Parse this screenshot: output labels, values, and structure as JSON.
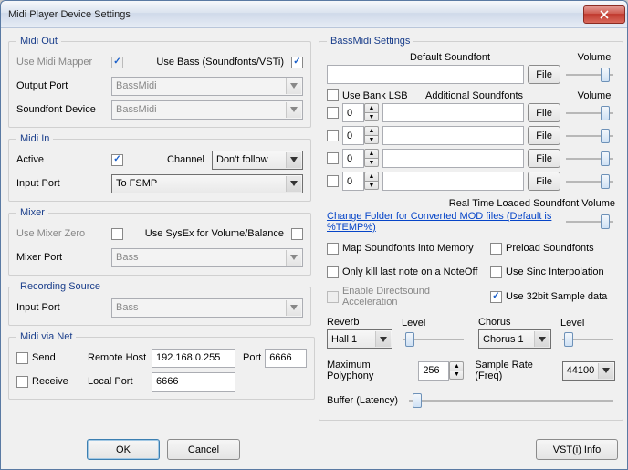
{
  "window": {
    "title": "Midi Player Device Settings"
  },
  "midiOut": {
    "legend": "Midi Out",
    "useMapper": "Use Midi Mapper",
    "useBass": "Use Bass (Soundfonts/VSTi)",
    "outputPort": "Output Port",
    "outputPortVal": "BassMidi",
    "sfDevice": "Soundfont Device",
    "sfDeviceVal": "BassMidi"
  },
  "midiIn": {
    "legend": "Midi In",
    "active": "Active",
    "channel": "Channel",
    "channelVal": "Don't follow",
    "inputPort": "Input Port",
    "inputPortVal": "To FSMP"
  },
  "mixer": {
    "legend": "Mixer",
    "useZero": "Use Mixer Zero",
    "useSysex": "Use SysEx for Volume/Balance",
    "mixerPort": "Mixer Port",
    "mixerPortVal": "Bass"
  },
  "rec": {
    "legend": "Recording Source",
    "inputPort": "Input Port",
    "inputPortVal": "Bass"
  },
  "net": {
    "legend": "Midi via Net",
    "send": "Send",
    "receive": "Receive",
    "remoteHost": "Remote Host",
    "remoteHostVal": "192.168.0.255",
    "port": "Port",
    "remotePortVal": "6666",
    "localPort": "Local Port",
    "localPortVal": "6666"
  },
  "buttons": {
    "ok": "OK",
    "cancel": "Cancel",
    "vst": "VST(i) Info",
    "file": "File"
  },
  "bass": {
    "legend": "BassMidi Settings",
    "defaultSf": "Default Soundfont",
    "volume": "Volume",
    "useBankLSB": "Use Bank LSB",
    "additionalSf": "Additional Soundfonts",
    "rows": [
      {
        "bank": "0",
        "path": ""
      },
      {
        "bank": "0",
        "path": ""
      },
      {
        "bank": "0",
        "path": ""
      },
      {
        "bank": "0",
        "path": ""
      }
    ],
    "rtVol": "Real Time Loaded Soundfont Volume",
    "changeFolder": "Change Folder for Converted MOD files (Default is %TEMP%)",
    "mapMem": "Map Soundfonts into Memory",
    "preload": "Preload Soundfonts",
    "killLast": "Only kill last note on a NoteOff",
    "sinc": "Use Sinc Interpolation",
    "dsAccel": "Enable Directsound Acceleration",
    "use32": "Use 32bit Sample data",
    "reverb": "Reverb",
    "reverbVal": "Hall 1",
    "level": "Level",
    "chorus": "Chorus",
    "chorusVal": "Chorus 1",
    "maxPoly": "Maximum Polyphony",
    "maxPolyVal": "256",
    "sampleRate": "Sample Rate (Freq)",
    "sampleRateVal": "44100",
    "buffer": "Buffer (Latency)"
  }
}
